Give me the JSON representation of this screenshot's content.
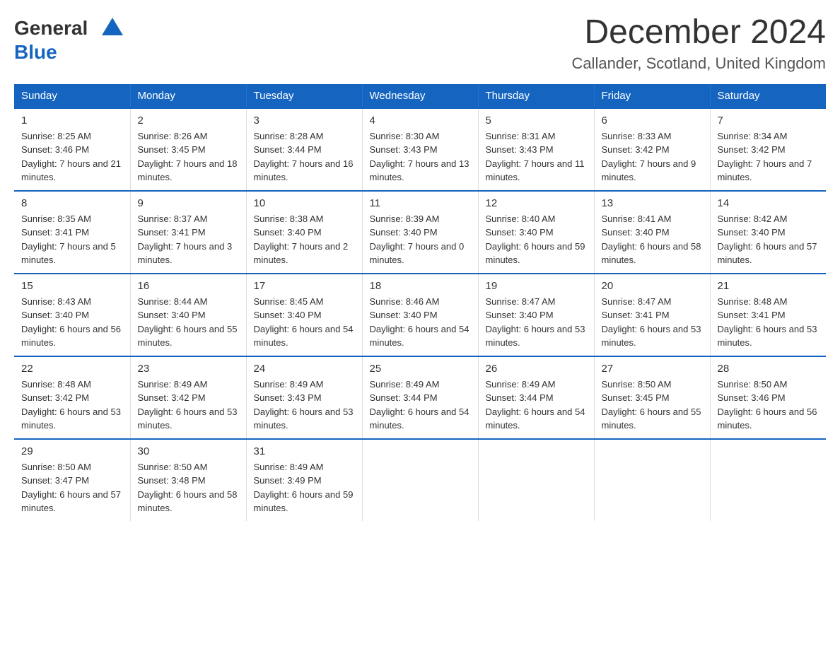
{
  "header": {
    "logo_general": "General",
    "logo_blue": "Blue",
    "month_title": "December 2024",
    "location": "Callander, Scotland, United Kingdom"
  },
  "days_of_week": [
    "Sunday",
    "Monday",
    "Tuesday",
    "Wednesday",
    "Thursday",
    "Friday",
    "Saturday"
  ],
  "weeks": [
    [
      {
        "num": "1",
        "sunrise": "8:25 AM",
        "sunset": "3:46 PM",
        "daylight": "7 hours and 21 minutes."
      },
      {
        "num": "2",
        "sunrise": "8:26 AM",
        "sunset": "3:45 PM",
        "daylight": "7 hours and 18 minutes."
      },
      {
        "num": "3",
        "sunrise": "8:28 AM",
        "sunset": "3:44 PM",
        "daylight": "7 hours and 16 minutes."
      },
      {
        "num": "4",
        "sunrise": "8:30 AM",
        "sunset": "3:43 PM",
        "daylight": "7 hours and 13 minutes."
      },
      {
        "num": "5",
        "sunrise": "8:31 AM",
        "sunset": "3:43 PM",
        "daylight": "7 hours and 11 minutes."
      },
      {
        "num": "6",
        "sunrise": "8:33 AM",
        "sunset": "3:42 PM",
        "daylight": "7 hours and 9 minutes."
      },
      {
        "num": "7",
        "sunrise": "8:34 AM",
        "sunset": "3:42 PM",
        "daylight": "7 hours and 7 minutes."
      }
    ],
    [
      {
        "num": "8",
        "sunrise": "8:35 AM",
        "sunset": "3:41 PM",
        "daylight": "7 hours and 5 minutes."
      },
      {
        "num": "9",
        "sunrise": "8:37 AM",
        "sunset": "3:41 PM",
        "daylight": "7 hours and 3 minutes."
      },
      {
        "num": "10",
        "sunrise": "8:38 AM",
        "sunset": "3:40 PM",
        "daylight": "7 hours and 2 minutes."
      },
      {
        "num": "11",
        "sunrise": "8:39 AM",
        "sunset": "3:40 PM",
        "daylight": "7 hours and 0 minutes."
      },
      {
        "num": "12",
        "sunrise": "8:40 AM",
        "sunset": "3:40 PM",
        "daylight": "6 hours and 59 minutes."
      },
      {
        "num": "13",
        "sunrise": "8:41 AM",
        "sunset": "3:40 PM",
        "daylight": "6 hours and 58 minutes."
      },
      {
        "num": "14",
        "sunrise": "8:42 AM",
        "sunset": "3:40 PM",
        "daylight": "6 hours and 57 minutes."
      }
    ],
    [
      {
        "num": "15",
        "sunrise": "8:43 AM",
        "sunset": "3:40 PM",
        "daylight": "6 hours and 56 minutes."
      },
      {
        "num": "16",
        "sunrise": "8:44 AM",
        "sunset": "3:40 PM",
        "daylight": "6 hours and 55 minutes."
      },
      {
        "num": "17",
        "sunrise": "8:45 AM",
        "sunset": "3:40 PM",
        "daylight": "6 hours and 54 minutes."
      },
      {
        "num": "18",
        "sunrise": "8:46 AM",
        "sunset": "3:40 PM",
        "daylight": "6 hours and 54 minutes."
      },
      {
        "num": "19",
        "sunrise": "8:47 AM",
        "sunset": "3:40 PM",
        "daylight": "6 hours and 53 minutes."
      },
      {
        "num": "20",
        "sunrise": "8:47 AM",
        "sunset": "3:41 PM",
        "daylight": "6 hours and 53 minutes."
      },
      {
        "num": "21",
        "sunrise": "8:48 AM",
        "sunset": "3:41 PM",
        "daylight": "6 hours and 53 minutes."
      }
    ],
    [
      {
        "num": "22",
        "sunrise": "8:48 AM",
        "sunset": "3:42 PM",
        "daylight": "6 hours and 53 minutes."
      },
      {
        "num": "23",
        "sunrise": "8:49 AM",
        "sunset": "3:42 PM",
        "daylight": "6 hours and 53 minutes."
      },
      {
        "num": "24",
        "sunrise": "8:49 AM",
        "sunset": "3:43 PM",
        "daylight": "6 hours and 53 minutes."
      },
      {
        "num": "25",
        "sunrise": "8:49 AM",
        "sunset": "3:44 PM",
        "daylight": "6 hours and 54 minutes."
      },
      {
        "num": "26",
        "sunrise": "8:49 AM",
        "sunset": "3:44 PM",
        "daylight": "6 hours and 54 minutes."
      },
      {
        "num": "27",
        "sunrise": "8:50 AM",
        "sunset": "3:45 PM",
        "daylight": "6 hours and 55 minutes."
      },
      {
        "num": "28",
        "sunrise": "8:50 AM",
        "sunset": "3:46 PM",
        "daylight": "6 hours and 56 minutes."
      }
    ],
    [
      {
        "num": "29",
        "sunrise": "8:50 AM",
        "sunset": "3:47 PM",
        "daylight": "6 hours and 57 minutes."
      },
      {
        "num": "30",
        "sunrise": "8:50 AM",
        "sunset": "3:48 PM",
        "daylight": "6 hours and 58 minutes."
      },
      {
        "num": "31",
        "sunrise": "8:49 AM",
        "sunset": "3:49 PM",
        "daylight": "6 hours and 59 minutes."
      },
      null,
      null,
      null,
      null
    ]
  ],
  "labels": {
    "sunrise": "Sunrise:",
    "sunset": "Sunset:",
    "daylight": "Daylight:"
  }
}
